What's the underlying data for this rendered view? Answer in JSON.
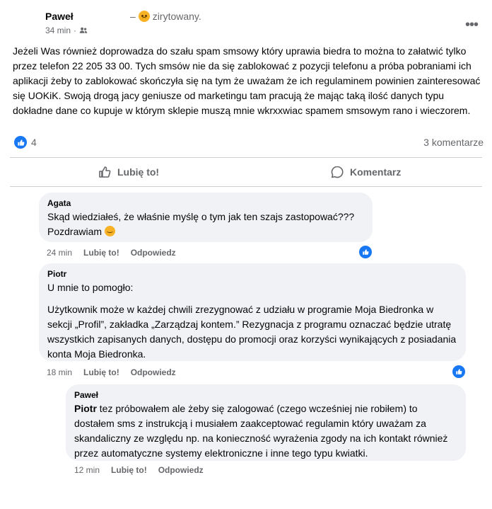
{
  "post": {
    "author": "Paweł",
    "status_prefix": "–",
    "status_text": "zirytowany.",
    "time": "34 min",
    "audience_icon": "friends-icon",
    "text": "Jeżeli Was również doprowadza do szału spam smsowy który uprawia biedra to można to załatwić tylko przez telefon 22 205 33 00. Tych smsów nie da się zablokować z pozycji telefonu a próba pobraniami ich aplikacji żeby to zablokować skończyła się na tym że uważam że ich regulaminem powinien zainteresować się UOKiK.  Swoją drogą jacy geniusze od marketingu tam pracują że mając taką ilość danych typu dokładne dane co kupuje w którym sklepie muszą mnie wkrxxwiac spamem smsowym rano i wieczorem.",
    "reaction_count": "4",
    "comments_count": "3 komentarze",
    "like_label": "Lubię to!",
    "comment_label": "Komentarz"
  },
  "comments": [
    {
      "author": "Agata",
      "text_line1": "Skąd wiedziałeś, że właśnie myślę o tym jak ten szajs zastopować???",
      "text_line2": "Pozdrawiam",
      "time": "24 min",
      "like": "Lubię to!",
      "reply": "Odpowiedz"
    },
    {
      "author": "Piotr",
      "text_intro": "U mnie to pomogło:",
      "text_quote": "Użytkownik może w każdej chwili zrezygnować z udziału w programie Moja Biedronka w sekcji „Profil”, zakładka „Zarządzaj kontem.” Rezygnacja z programu oznaczać będzie utratę wszystkich zapisanych danych, dostępu do promocji oraz korzyści wynikających z posiadania konta Moja Biedronka.",
      "time": "18 min",
      "like": "Lubię to!",
      "reply": "Odpowiedz"
    },
    {
      "author": "Paweł",
      "mention": "Piotr",
      "text": " tez próbowałem ale żeby się zalogować (czego wcześniej nie robiłem) to dostałem sms z instrukcją i musiałem zaakceptować regulamin który uważam za skandaliczny ze względu np. na konieczność wyrażenia zgody na ich kontakt również przez automatyczne systemy elektroniczne i inne tego typu kwiatki.",
      "time": "12 min",
      "like": "Lubię to!",
      "reply": "Odpowiedz"
    }
  ],
  "colors": {
    "accent": "#1877f2",
    "bubble": "#f0f2f5",
    "muted": "#65676b"
  }
}
